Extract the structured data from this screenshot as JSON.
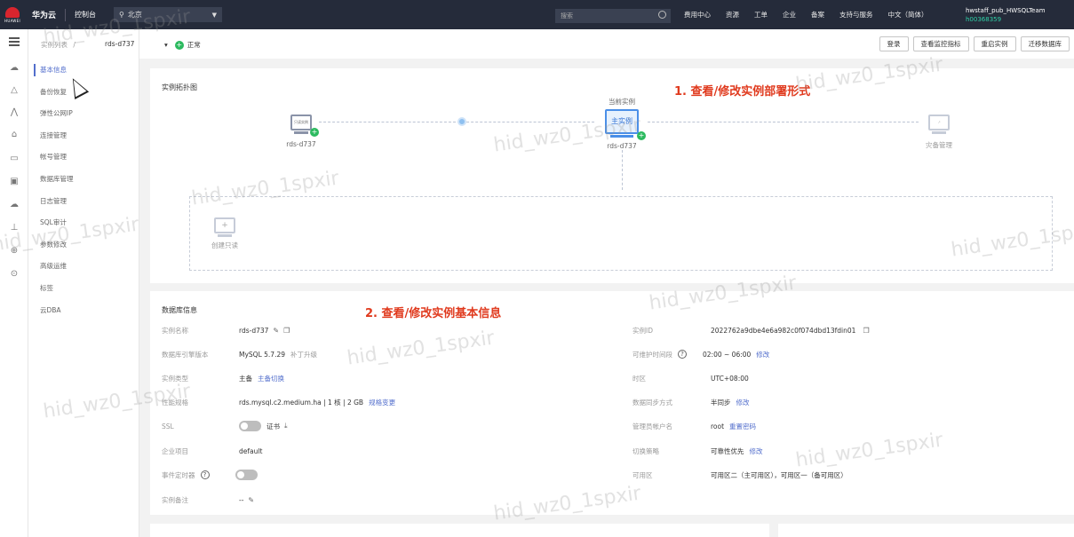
{
  "topbar": {
    "logo_text": "HUAWEI",
    "brand": "华为云",
    "console": "控制台",
    "region": "北京",
    "search_placeholder": "搜索",
    "nav": [
      "费用中心",
      "资源",
      "工单",
      "企业",
      "备案",
      "支持与服务",
      "中文（简体）"
    ],
    "user_name": "hwstaff_pub_HWSQLTeam",
    "user_id": "h00368359"
  },
  "breadcrumb": {
    "parent": "实例列表",
    "sep": "/",
    "current": "rds-d737"
  },
  "header": {
    "instance": "rds-d737",
    "status": "正常",
    "buttons": [
      "登录",
      "查看监控指标",
      "重启实例",
      "迁移数据库"
    ]
  },
  "sidebar": {
    "items": [
      "基本信息",
      "备份恢复",
      "弹性公网IP",
      "连接管理",
      "帐号管理",
      "数据库管理",
      "日志管理",
      "SQL审计",
      "参数修改",
      "高级运维",
      "标签",
      "云DBA"
    ]
  },
  "topology": {
    "title": "实例拓扑图",
    "annotation": "1. 查看/修改实例部署形式",
    "left_node_label": "rds-d737",
    "left_node_inner": "只读实例",
    "current_label": "当前实例",
    "main_inner": "主实例",
    "main_node_label": "rds-d737",
    "right_node_label": "灾备管理",
    "create_label": "创建只读"
  },
  "dbinfo": {
    "title": "数据库信息",
    "annotation": "2. 查看/修改实例基本信息",
    "left_rows": [
      {
        "label": "实例名称",
        "value": "rds-d737"
      },
      {
        "label": "数据库引擎版本",
        "value": "MySQL 5.7.29",
        "link": "补丁升级"
      },
      {
        "label": "实例类型",
        "value": "主备",
        "link": "主备切换"
      },
      {
        "label": "性能规格",
        "value": "rds.mysql.c2.medium.ha | 1 核 | 2 GB",
        "link": "规格变更"
      },
      {
        "label": "SSL",
        "value": "证书"
      },
      {
        "label": "企业项目",
        "value": "default"
      },
      {
        "label": "事件定时器",
        "value": ""
      },
      {
        "label": "实例备注",
        "value": "--"
      }
    ],
    "right_rows": [
      {
        "label": "实例ID",
        "value": "2022762a9dbe4e6a982c0f074dbd13fdin01"
      },
      {
        "label": "可维护时间段",
        "value": "02:00 ~ 06:00",
        "link": "修改"
      },
      {
        "label": "时区",
        "value": "UTC+08:00"
      },
      {
        "label": "数据同步方式",
        "value": "半同步",
        "link": "修改"
      },
      {
        "label": "管理员帐户名",
        "value": "root",
        "link": "重置密码"
      },
      {
        "label": "切换策略",
        "value": "可靠性优先",
        "link": "修改"
      },
      {
        "label": "可用区",
        "value": "可用区二（主可用区），可用区一（备可用区）"
      }
    ]
  },
  "watermark": "hid_wz0_1spxir"
}
